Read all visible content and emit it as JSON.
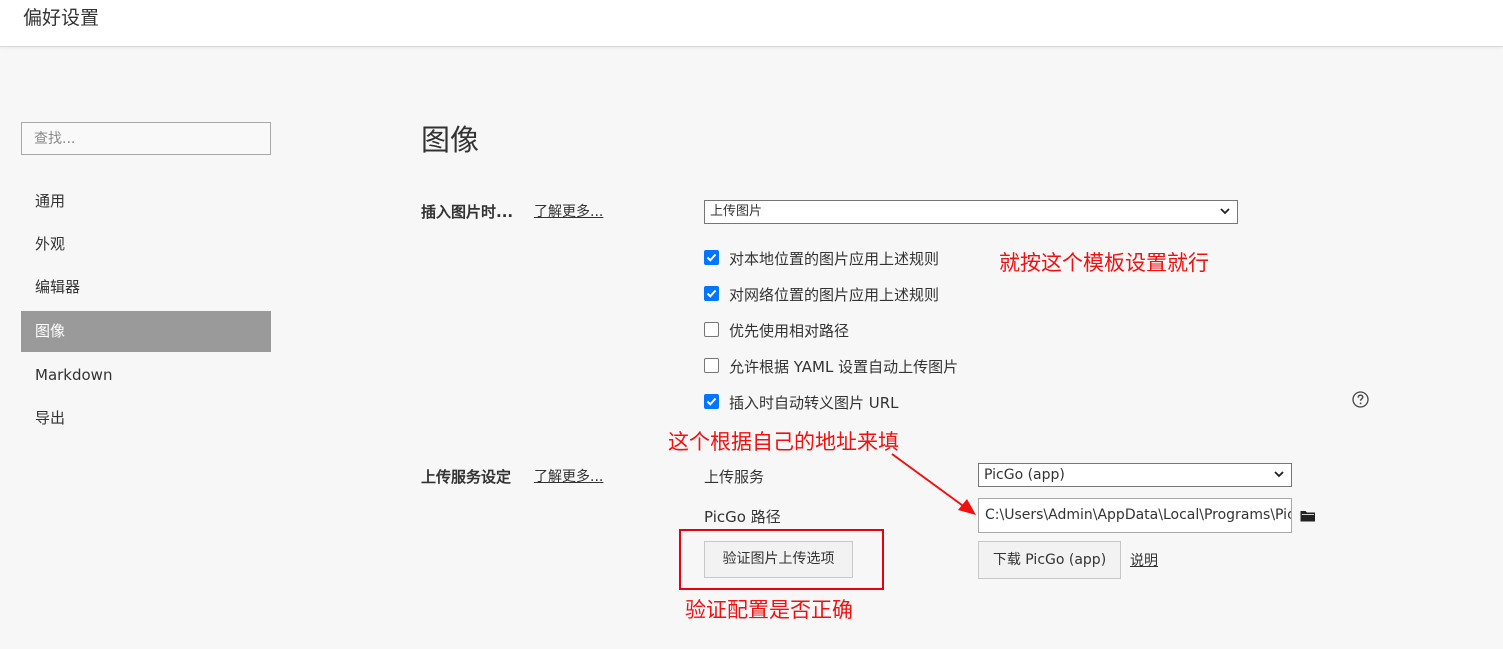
{
  "window": {
    "title": "偏好设置"
  },
  "sidebar": {
    "search_placeholder": "查找...",
    "items": [
      {
        "label": "通用",
        "active": false
      },
      {
        "label": "外观",
        "active": false
      },
      {
        "label": "编辑器",
        "active": false
      },
      {
        "label": "图像",
        "active": true
      },
      {
        "label": "Markdown",
        "active": false
      },
      {
        "label": "导出",
        "active": false
      }
    ]
  },
  "main": {
    "title": "图像",
    "insert_image": {
      "label": "插入图片时...",
      "learn_more": "了解更多...",
      "action_value": "上传图片",
      "options": [
        {
          "label": "对本地位置的图片应用上述规则",
          "checked": true
        },
        {
          "label": "对网络位置的图片应用上述规则",
          "checked": true
        },
        {
          "label": "优先使用相对路径",
          "checked": false
        },
        {
          "label": "允许根据 YAML 设置自动上传图片",
          "checked": false
        },
        {
          "label": "插入时自动转义图片 URL",
          "checked": true
        }
      ]
    },
    "upload_service": {
      "label": "上传服务设定",
      "learn_more": "了解更多...",
      "service_label": "上传服务",
      "service_value": "PicGo (app)",
      "path_label": "PicGo 路径",
      "path_value": "C:\\Users\\Admin\\AppData\\Local\\Programs\\PicGo",
      "verify_button": "验证图片上传选项",
      "download_button": "下载 PicGo (app)",
      "help_link": "说明"
    }
  },
  "annotations": {
    "template_note": "就按这个模板设置就行",
    "path_note": "这个根据自己的地址来填",
    "verify_note": "验证配置是否正确",
    "color": "#f01010"
  },
  "colors": {
    "accent": "#0075ff",
    "nav_active": "#9a9a9a",
    "annotation": "#f01010"
  }
}
